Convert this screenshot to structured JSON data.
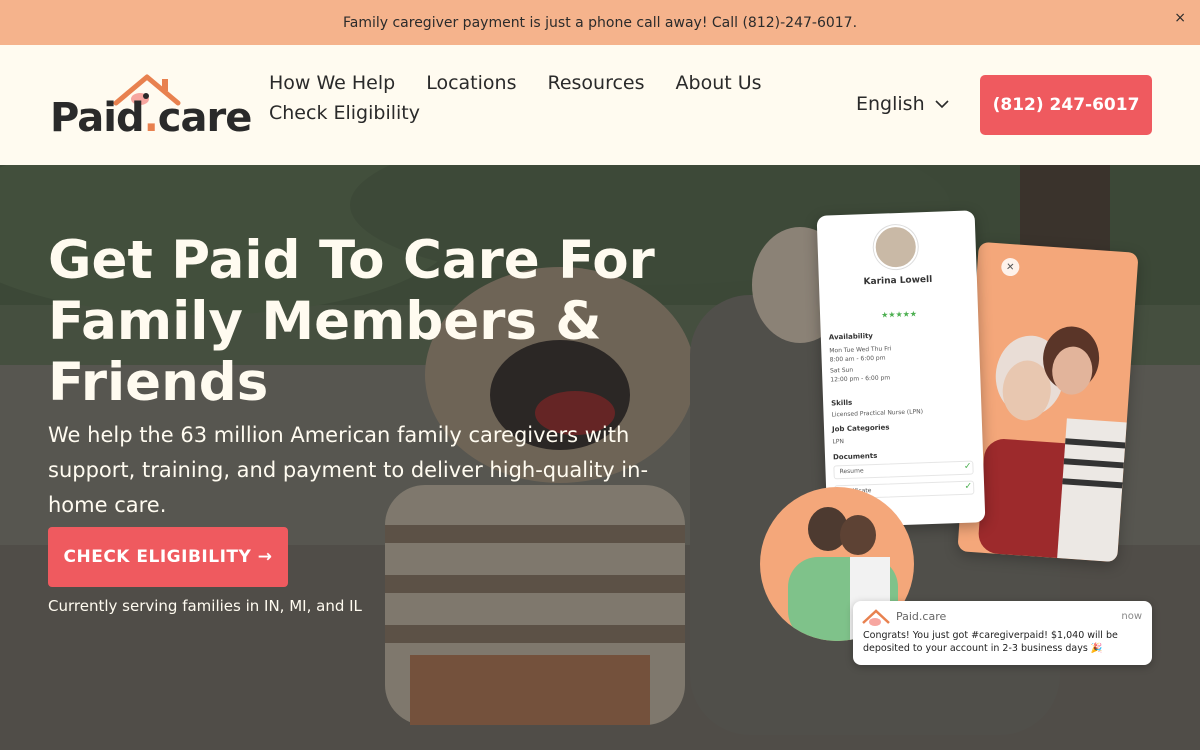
{
  "banner": {
    "text": "Family caregiver payment is just a phone call away! Call (812)-247-6017.",
    "close_icon": "×"
  },
  "header": {
    "logo": {
      "word_left": "Paid",
      "dot": ".",
      "word_right": "care"
    },
    "nav": {
      "row1": [
        "How We Help",
        "Locations",
        "Resources",
        "About Us"
      ],
      "row2": [
        "Check Eligibility"
      ]
    },
    "language": "English",
    "phone_button": "(812) 247-6017"
  },
  "hero": {
    "title": "Get Paid To Care For Family Members & Friends",
    "subtitle": "We help the 63 million American family caregivers with support, training, and payment to deliver high-quality in-home care.",
    "cta": "CHECK ELIGIBILITY →",
    "serving": "Currently serving families in IN, MI, and IL"
  },
  "profile_card": {
    "name": "Karina Lowell",
    "stars": "★★★★★",
    "availability": "Availability",
    "days1": "Mon Tue Wed Thu Fri",
    "time1": "8:00 am - 6:00 pm",
    "days2": "Sat Sun",
    "time2": "12:00 pm - 6:00 pm",
    "skills": "Skills",
    "skill_line": "Licensed Practical Nurse (LPN)",
    "job_categories": "Job Categories",
    "job_line": "LPN",
    "documents": "Documents",
    "doc1": "Resume",
    "doc2": "Certificate"
  },
  "notification": {
    "app": "Paid.care",
    "time": "now",
    "message": "Congrats! You just got #caregiverpaid! $1,040 will be deposited to your account in 2-3 business days 🎉"
  },
  "colors": {
    "banner": "#f5b38c",
    "accent": "#ef5a5f",
    "cream": "#fffbf0",
    "orange": "#f4a77a"
  }
}
